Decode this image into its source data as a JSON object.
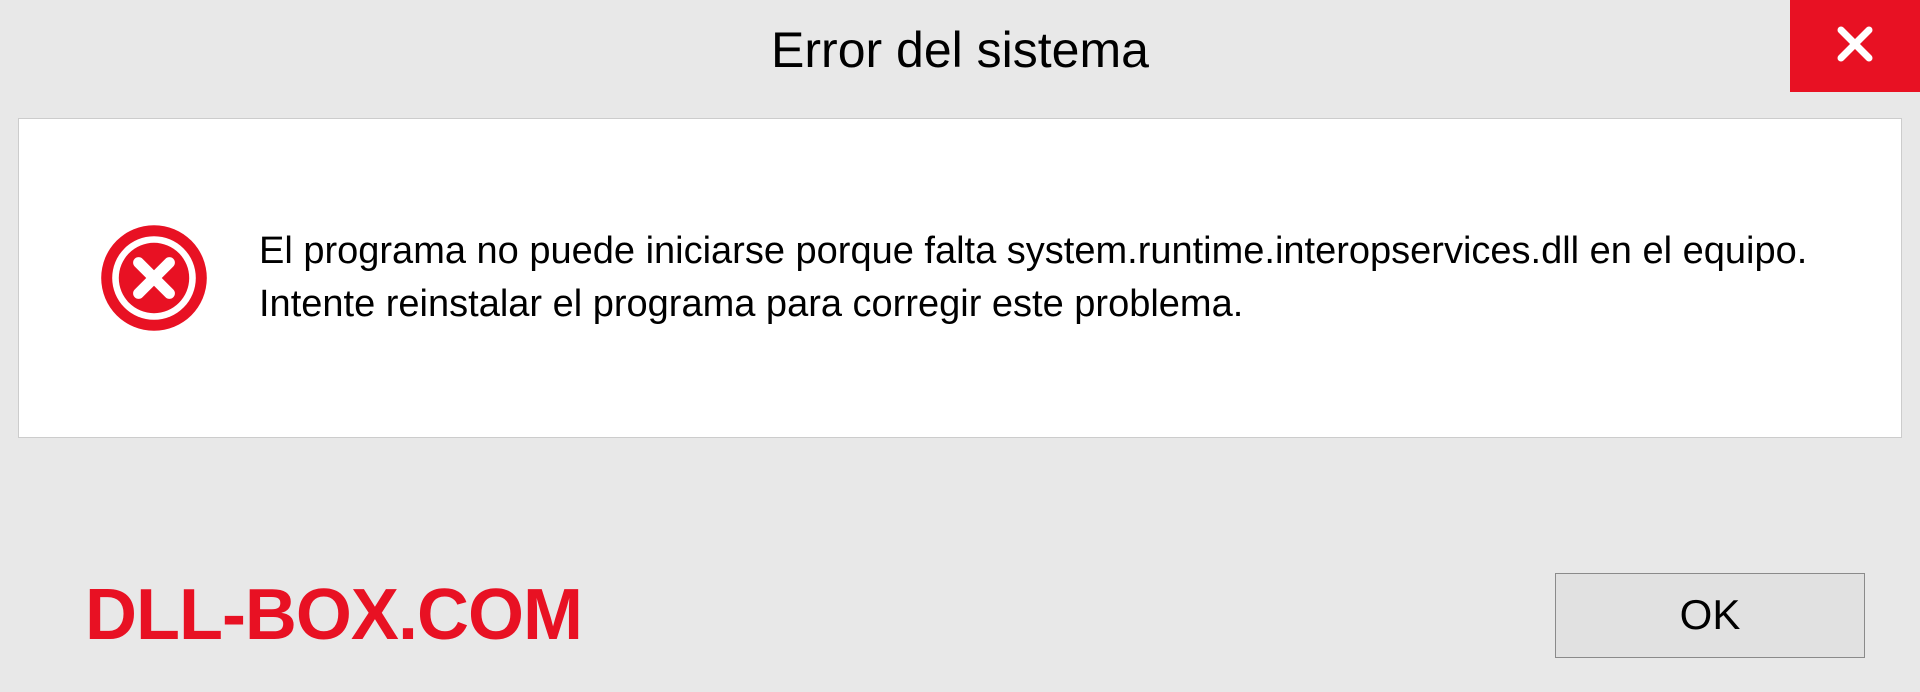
{
  "dialog": {
    "title": "Error del sistema",
    "message": "El programa no puede iniciarse porque falta system.runtime.interopservices.dll en el equipo. Intente reinstalar el programa para corregir este problema.",
    "ok_label": "OK"
  },
  "watermark": "DLL-BOX.COM",
  "colors": {
    "close_bg": "#e81123",
    "error_icon": "#e81123",
    "watermark": "#e81123"
  }
}
